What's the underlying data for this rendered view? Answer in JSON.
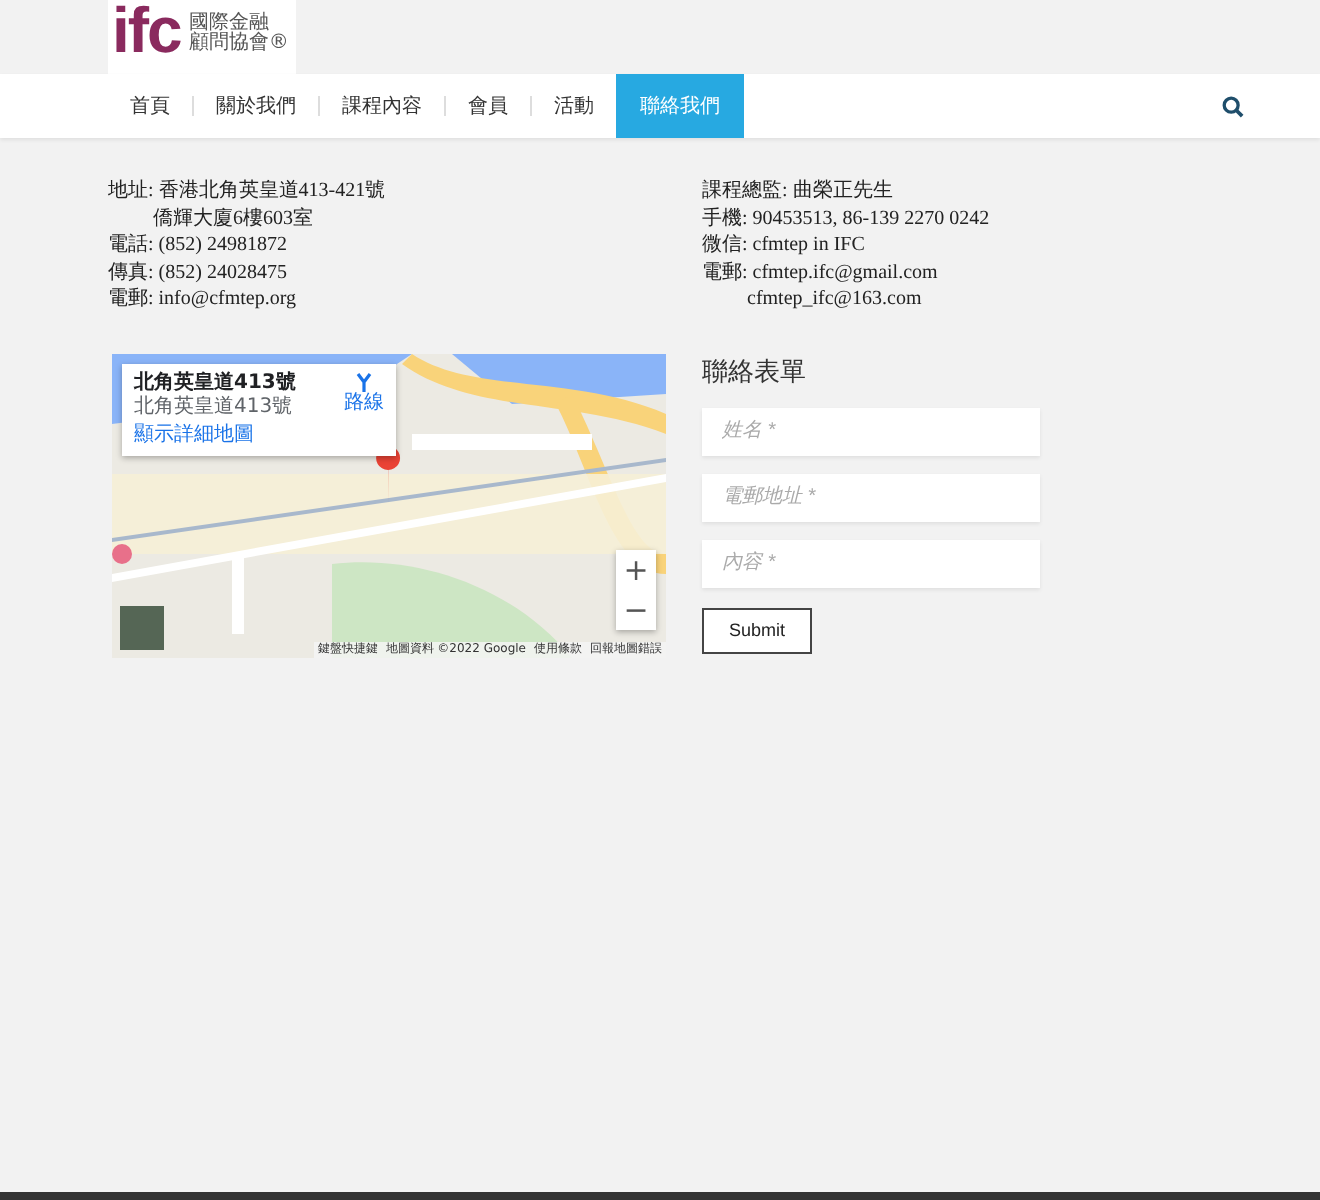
{
  "logo": {
    "mark": "ifc",
    "name_lines": [
      "國際金融",
      "顧問協會®"
    ]
  },
  "nav": {
    "items": [
      {
        "label": "首頁",
        "selected": false
      },
      {
        "label": "關於我們",
        "selected": false
      },
      {
        "label": "課程內容",
        "selected": false
      },
      {
        "label": "會員",
        "selected": false
      },
      {
        "label": "活動",
        "selected": false
      },
      {
        "label": "聯絡我們",
        "selected": true
      }
    ]
  },
  "contact_left": [
    "地址: 香港北角英皇道413-421號",
    "　　 僑輝大廈6樓603室",
    "電話: (852) 24981872",
    "傳真: (852) 24028475",
    "電郵: info@cfmtep.org"
  ],
  "contact_right": [
    "課程總監: 曲榮正先生",
    "手機: 90453513, 86-139 2270 0242",
    "微信: cfmtep in IFC",
    "電郵: cfmtep.ifc@gmail.com",
    "　　 cfmtep_ifc@163.com"
  ],
  "map": {
    "card_title": "北角英皇道413號",
    "card_address": "北角英皇道413號",
    "directions": "路線",
    "larger_map": "顯示詳細地圖",
    "zoom_in": "+",
    "zoom_out": "−",
    "footer": [
      "鍵盤快捷鍵",
      "地圖資料 ©2022 Google",
      "使用條款",
      "回報地圖錯誤"
    ]
  },
  "form": {
    "title": "聯絡表單",
    "fields": [
      {
        "placeholder": "姓名 *"
      },
      {
        "placeholder": "電郵地址 *"
      },
      {
        "placeholder": "內容 *"
      }
    ],
    "submit": "Submit"
  }
}
